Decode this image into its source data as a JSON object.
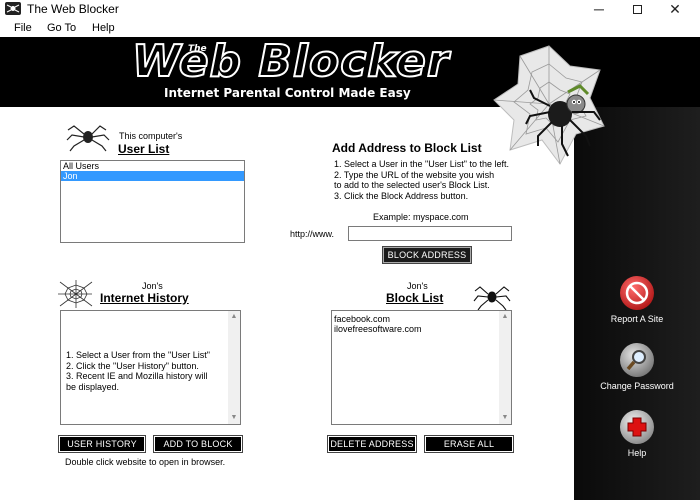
{
  "window": {
    "title": "The Web Blocker",
    "minimize_glyph": "─",
    "close_glyph": "✕"
  },
  "menu": [
    "File",
    "Go To",
    "Help"
  ],
  "banner": {
    "the": "The",
    "title": "Web Blocker",
    "tagline": "Internet Parental Control Made Easy"
  },
  "user_list": {
    "caption": "This computer's",
    "title": "User List",
    "items": [
      {
        "label": "All Users",
        "selected": false
      },
      {
        "label": "Jon",
        "selected": true
      }
    ]
  },
  "add_address": {
    "title": "Add Address to Block List",
    "instructions": "1. Select a User in the \"User List\" to the left.\n2. Type the URL of the website you wish\n to add to the selected user's Block List.\n3. Click the Block Address button.",
    "example": "Example: myspace.com",
    "prefix": "http://www.",
    "url_value": "",
    "block_button": "BLOCK ADDRESS"
  },
  "history": {
    "caption": "Jon's",
    "title": "Internet History",
    "instructions": "1. Select a User from the \"User List\"\n2. Click the \"User History\" button.\n3. Recent IE and Mozilla history will\nbe displayed.",
    "user_history_button": "USER HISTORY",
    "add_to_block_button": "ADD TO BLOCK",
    "hint": "Double click website to open in browser."
  },
  "block_list": {
    "caption": "Jon's",
    "title": "Block List",
    "items": [
      "facebook.com",
      "ilovefreesoftware.com"
    ],
    "delete_button": "DELETE ADDRESS",
    "erase_button": "ERASE ALL"
  },
  "side": {
    "report": "Report A Site",
    "password": "Change Password",
    "help": "Help"
  },
  "colors": {
    "selection": "#3399ff",
    "banner_bg": "#000000",
    "report_icon": "#cc0000",
    "help_icon": "#dd1111"
  }
}
